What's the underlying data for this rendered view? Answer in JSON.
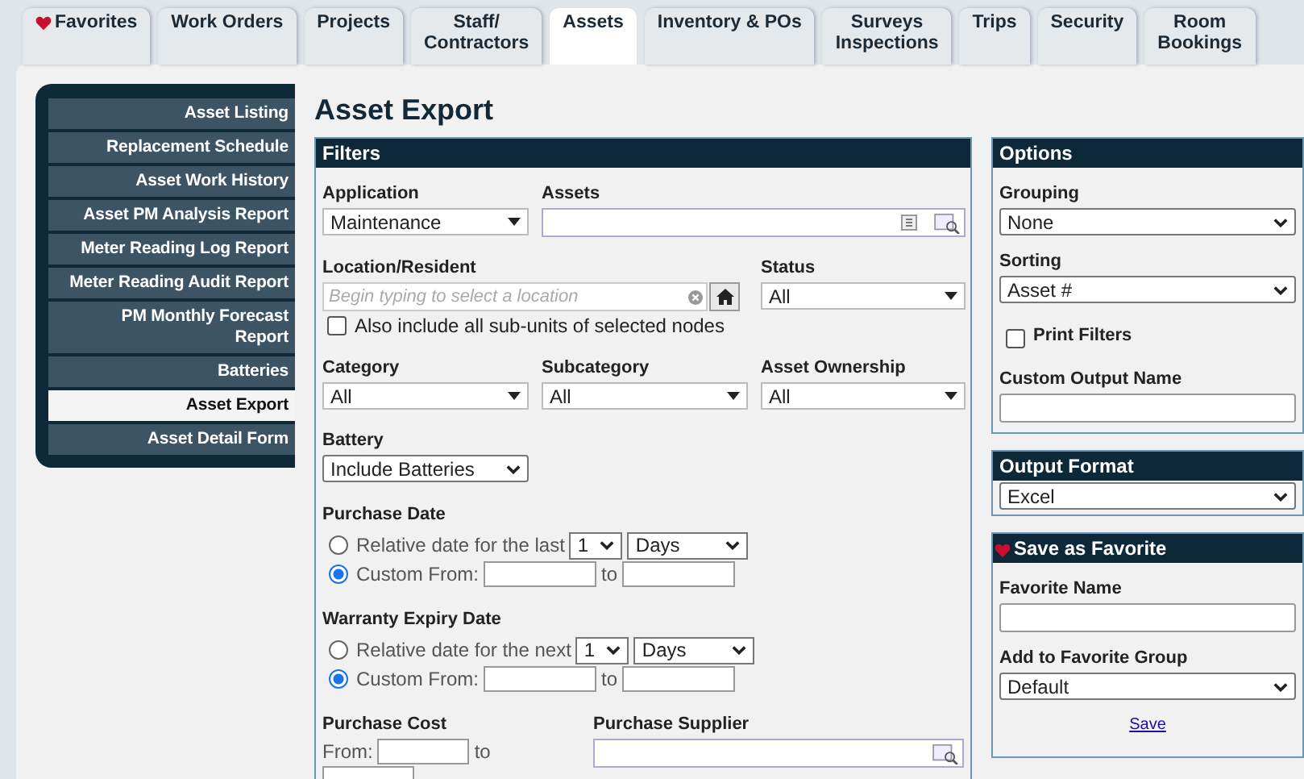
{
  "tabs": [
    {
      "label": "Favorites",
      "kind": "favorites",
      "selected": false
    },
    {
      "label": "Work Orders",
      "kind": "plain",
      "selected": false
    },
    {
      "label": "Projects",
      "kind": "plain",
      "selected": false
    },
    {
      "label": "Staff/\nContractors",
      "kind": "plain",
      "selected": false
    },
    {
      "label": "Assets",
      "kind": "plain",
      "selected": true
    },
    {
      "label": "Inventory & POs",
      "kind": "plain",
      "selected": false
    },
    {
      "label": "Surveys\nInspections",
      "kind": "plain",
      "selected": false
    },
    {
      "label": "Trips",
      "kind": "plain",
      "selected": false
    },
    {
      "label": "Security",
      "kind": "plain",
      "selected": false
    },
    {
      "label": "Room\nBookings",
      "kind": "plain",
      "selected": false
    }
  ],
  "sidebar": {
    "items": [
      {
        "label": "Asset Listing",
        "selected": false
      },
      {
        "label": "Replacement Schedule",
        "selected": false
      },
      {
        "label": "Asset Work History",
        "selected": false
      },
      {
        "label": "Asset PM Analysis Report",
        "selected": false
      },
      {
        "label": "Meter Reading Log Report",
        "selected": false
      },
      {
        "label": "Meter Reading Audit Report",
        "selected": false
      },
      {
        "label": "PM Monthly Forecast Report",
        "selected": false
      },
      {
        "label": "Batteries",
        "selected": false
      },
      {
        "label": "Asset Export",
        "selected": true
      },
      {
        "label": "Asset Detail Form",
        "selected": false
      }
    ]
  },
  "page_title": "Asset Export",
  "filters": {
    "title": "Filters",
    "application": {
      "label": "Application",
      "value": "Maintenance"
    },
    "assets": {
      "label": "Assets"
    },
    "location": {
      "label": "Location/Resident",
      "placeholder": "Begin typing to select a location"
    },
    "status": {
      "label": "Status",
      "value": "All"
    },
    "include_subunits": {
      "label": "Also include all sub-units of selected nodes",
      "checked": false
    },
    "category": {
      "label": "Category",
      "value": "All"
    },
    "subcategory": {
      "label": "Subcategory",
      "value": "All"
    },
    "ownership": {
      "label": "Asset Ownership",
      "value": "All"
    },
    "battery": {
      "label": "Battery",
      "value": "Include Batteries"
    },
    "purchase_date": {
      "label": "Purchase Date",
      "relative": {
        "label": "Relative date for the last",
        "selected": false,
        "count": "1",
        "unit": "Days"
      },
      "custom": {
        "label": "Custom From:",
        "selected": true,
        "to": "to"
      }
    },
    "warranty_expiry": {
      "label": "Warranty Expiry Date",
      "relative": {
        "label": "Relative date for the next",
        "selected": false,
        "count": "1",
        "unit": "Days"
      },
      "custom": {
        "label": "Custom From:",
        "selected": true,
        "to": "to"
      }
    },
    "purchase_cost": {
      "label": "Purchase Cost",
      "from": "From:",
      "to": "to"
    },
    "purchase_supplier": {
      "label": "Purchase Supplier"
    }
  },
  "options": {
    "title": "Options",
    "grouping": {
      "label": "Grouping",
      "value": "None"
    },
    "sorting": {
      "label": "Sorting",
      "value": "Asset #"
    },
    "print_filters": {
      "label": "Print Filters",
      "checked": false
    },
    "custom_output_name": {
      "label": "Custom Output Name"
    }
  },
  "output_format": {
    "title": "Output Format",
    "value": "Excel"
  },
  "save_favorite": {
    "title": "Save as Favorite",
    "favorite_name": {
      "label": "Favorite Name"
    },
    "group": {
      "label": "Add to Favorite Group",
      "value": "Default"
    },
    "save_link": "Save"
  }
}
